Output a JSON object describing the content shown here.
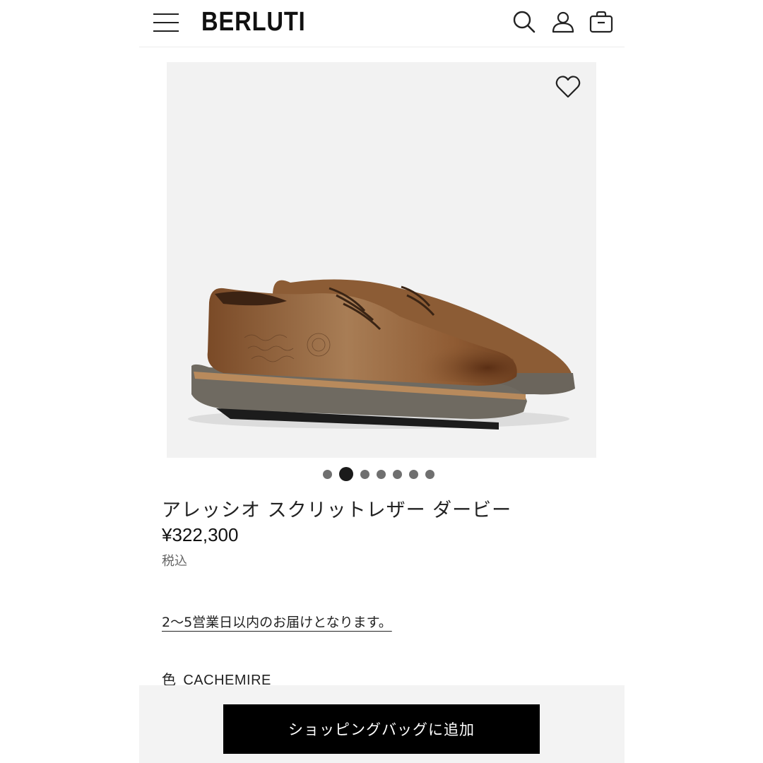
{
  "header": {
    "logo": "BERLUTI",
    "icons": [
      "menu-icon",
      "search-icon",
      "account-icon",
      "shopping-bag-icon"
    ]
  },
  "product": {
    "image_icon": "shoe-image",
    "wishlist_icon": "heart-icon",
    "carousel": {
      "total": 7,
      "active_index": 1
    },
    "title": "アレッシオ スクリットレザー ダービー",
    "price": "¥322,300",
    "tax_note": "税込",
    "delivery_note": "2〜5営業日以内のお届けとなります。",
    "color_label": "色",
    "color_value": "CACHEMIRE"
  },
  "cta": {
    "add_to_bag": "ショッピングバッグに追加"
  },
  "colors": {
    "accent": "#000000",
    "bar_bg": "#f3f3f3",
    "image_bg": "#f2f2f2",
    "leather": "#8a5a33"
  }
}
